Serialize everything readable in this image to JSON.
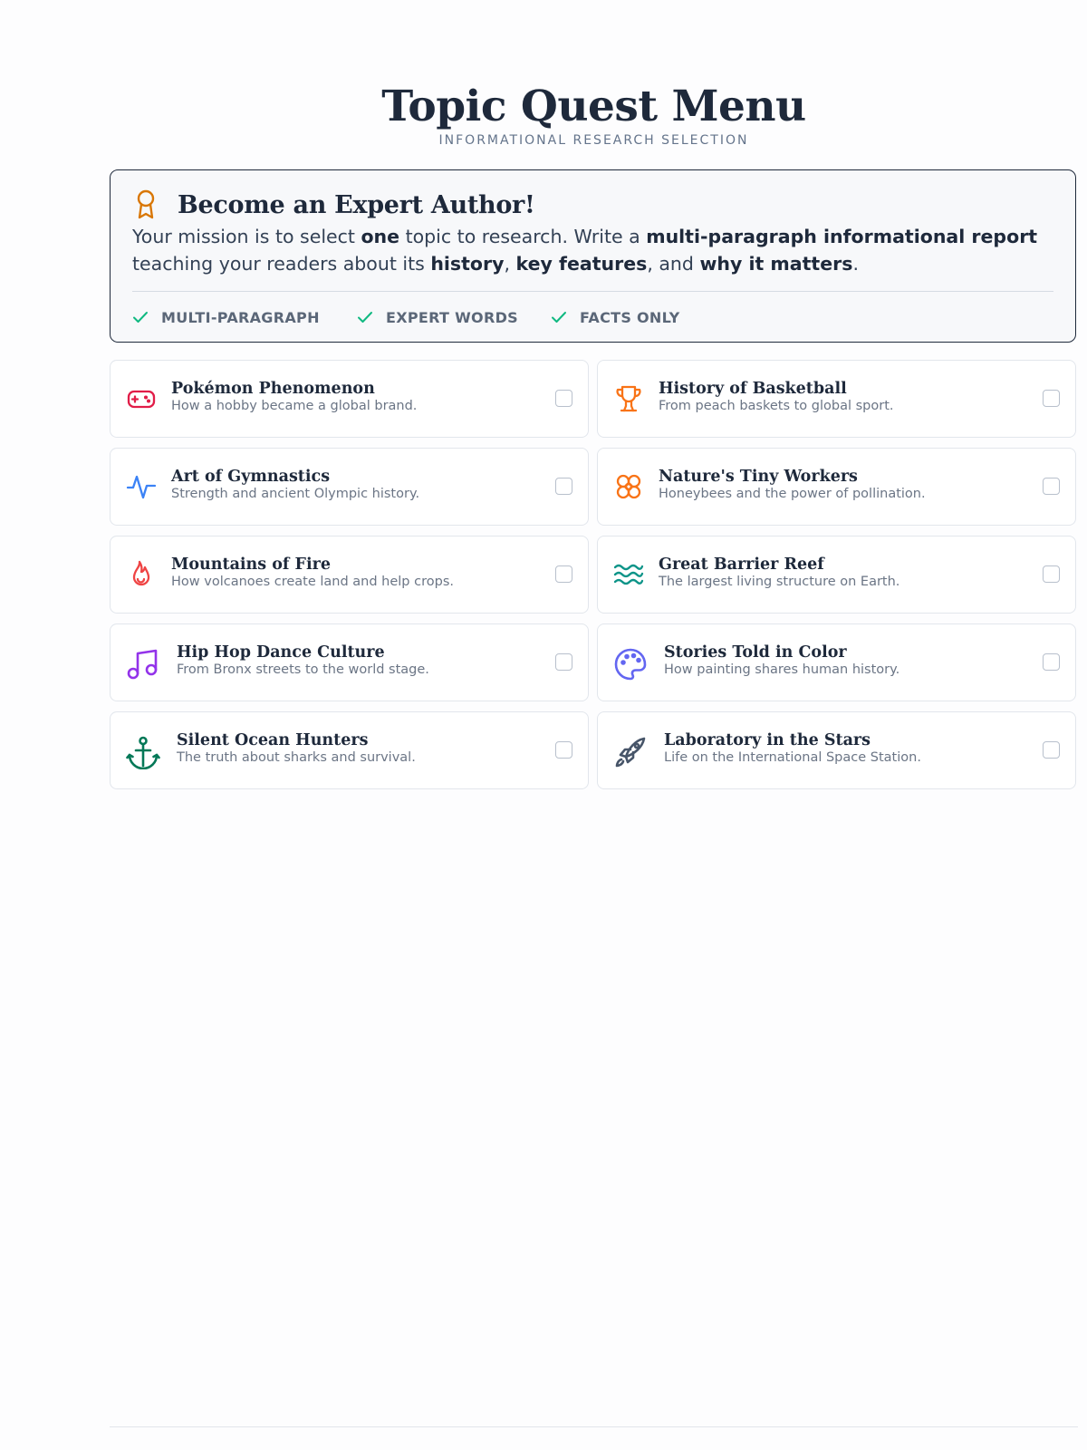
{
  "header": {
    "title": "Topic Quest Menu",
    "subtitle": "INFORMATIONAL RESEARCH SELECTION"
  },
  "mission": {
    "icon": "award-ribbon-icon",
    "title": "Become an Expert Author!",
    "text": {
      "p1": "Your mission is to select ",
      "b1": "one",
      "p2": " topic to research. Write a ",
      "b2": "multi-paragraph informational report",
      "p3": " teaching your readers about its ",
      "b3": "history",
      "p4": ", ",
      "b4": "key features",
      "p5": ", and ",
      "b5": "why it matters",
      "p6": "."
    },
    "criteria": [
      {
        "label": "MULTI-PARAGRAPH",
        "icon": "check-icon"
      },
      {
        "label": "EXPERT WORDS",
        "icon": "check-icon"
      },
      {
        "label": "FACTS ONLY",
        "icon": "check-icon"
      }
    ]
  },
  "topics": [
    {
      "title": "Pokémon Phenomenon",
      "desc": "How a hobby became a global brand.",
      "icon": "gamepad-icon",
      "color": "#e11d48",
      "checked": false
    },
    {
      "title": "History of Basketball",
      "desc": "From peach baskets to global sport.",
      "icon": "trophy-icon",
      "color": "#f97316",
      "checked": false
    },
    {
      "title": "Art of Gymnastics",
      "desc": "Strength and ancient Olympic history.",
      "icon": "activity-icon",
      "color": "#3b82f6",
      "checked": false
    },
    {
      "title": "Nature's Tiny Workers",
      "desc": "Honeybees and the power of pollination.",
      "icon": "flower-icon",
      "color": "#f97316",
      "checked": false
    },
    {
      "title": "Mountains of Fire",
      "desc": "How volcanoes create land and help crops.",
      "icon": "flame-icon",
      "color": "#ef4444",
      "checked": false
    },
    {
      "title": "Great Barrier Reef",
      "desc": "The largest living structure on Earth.",
      "icon": "waves-icon",
      "color": "#0d9488",
      "checked": false
    },
    {
      "title": "Hip Hop Dance Culture",
      "desc": "From Bronx streets to the world stage.",
      "icon": "music-icon",
      "color": "#9333ea",
      "checked": false
    },
    {
      "title": "Stories Told in Color",
      "desc": "How painting shares human history.",
      "icon": "palette-icon",
      "color": "#6366f1",
      "checked": false
    },
    {
      "title": "Silent Ocean Hunters",
      "desc": "The truth about sharks and survival.",
      "icon": "anchor-icon",
      "color": "#047857",
      "checked": false
    },
    {
      "title": "Laboratory in the Stars",
      "desc": "Life on the International Space Station.",
      "icon": "rocket-icon",
      "color": "#475569",
      "checked": false
    }
  ],
  "colors": {
    "accent_award": "#d97706",
    "check": "#10b981"
  }
}
